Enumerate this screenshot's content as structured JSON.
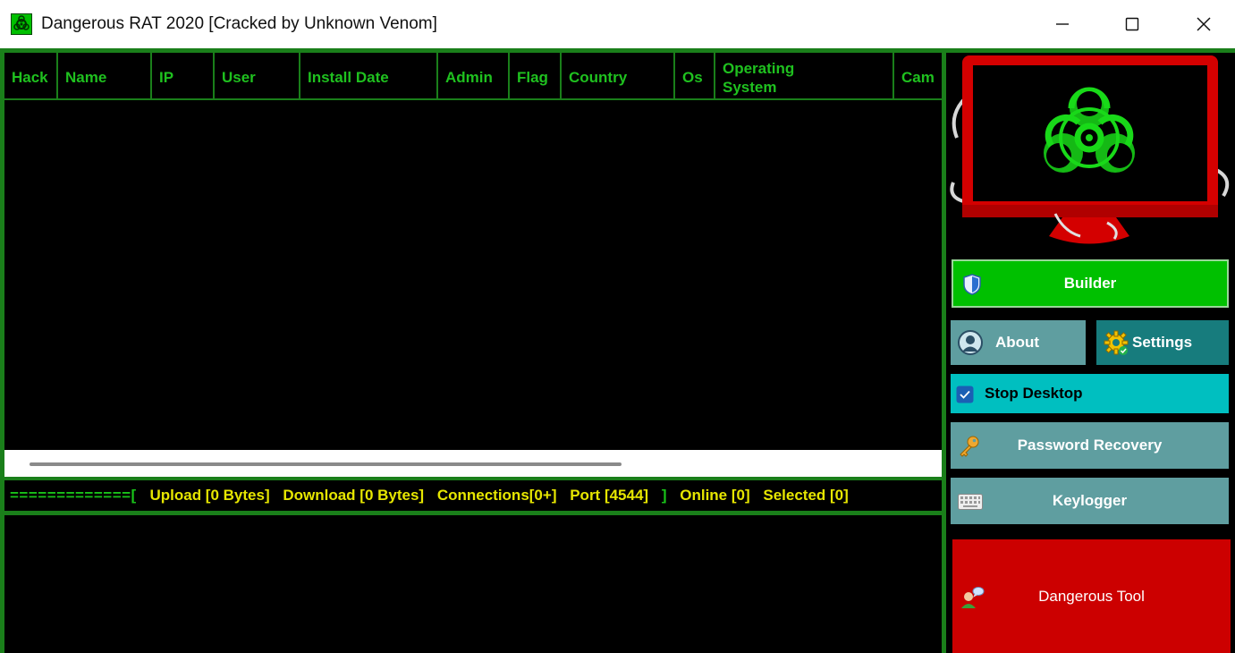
{
  "window": {
    "title": "Dangerous RAT 2020 [Cracked by Unknown Venom]",
    "minimize_glyph": "—",
    "maximize_glyph": "☐",
    "close_glyph": "✕"
  },
  "table": {
    "columns": [
      "Hack",
      "Name",
      "IP",
      "User",
      "Install Date",
      "Admin",
      "Flag",
      "Country",
      "Os",
      "Operating System",
      "Cam"
    ],
    "rows": []
  },
  "status": {
    "separator": "=============[",
    "upload": "Upload [0 Bytes]",
    "download": "Download [0 Bytes]",
    "connections": "Connections[0+]",
    "port": "Port [4544]",
    "bracket_close": "]",
    "online": "Online [0]",
    "selected": "Selected [0]"
  },
  "side": {
    "builder_label": "Builder",
    "about_label": "About",
    "settings_label": "Settings",
    "stop_desktop_label": "Stop Desktop",
    "stop_desktop_checked": true,
    "password_recovery_label": "Password Recovery",
    "keylogger_label": "Keylogger",
    "dangerous_tool_label": "Dangerous Tool"
  },
  "icons": {
    "app": "biohazard-icon",
    "builder": "shield-icon",
    "about": "user-icon",
    "settings": "gear-icon",
    "password": "key-icon",
    "keylogger": "keyboard-icon",
    "dangerous": "user-chat-icon",
    "monitor": "biohazard-monitor-image"
  },
  "colors": {
    "frame_green": "#1a7f1a",
    "text_green": "#1fc11f",
    "status_yellow": "#e6e600",
    "builder_green": "#00c000",
    "teal": "#5f9ea0",
    "dark_teal": "#177c7d",
    "cyan": "#00bfc0",
    "danger_red": "#cc0000"
  }
}
